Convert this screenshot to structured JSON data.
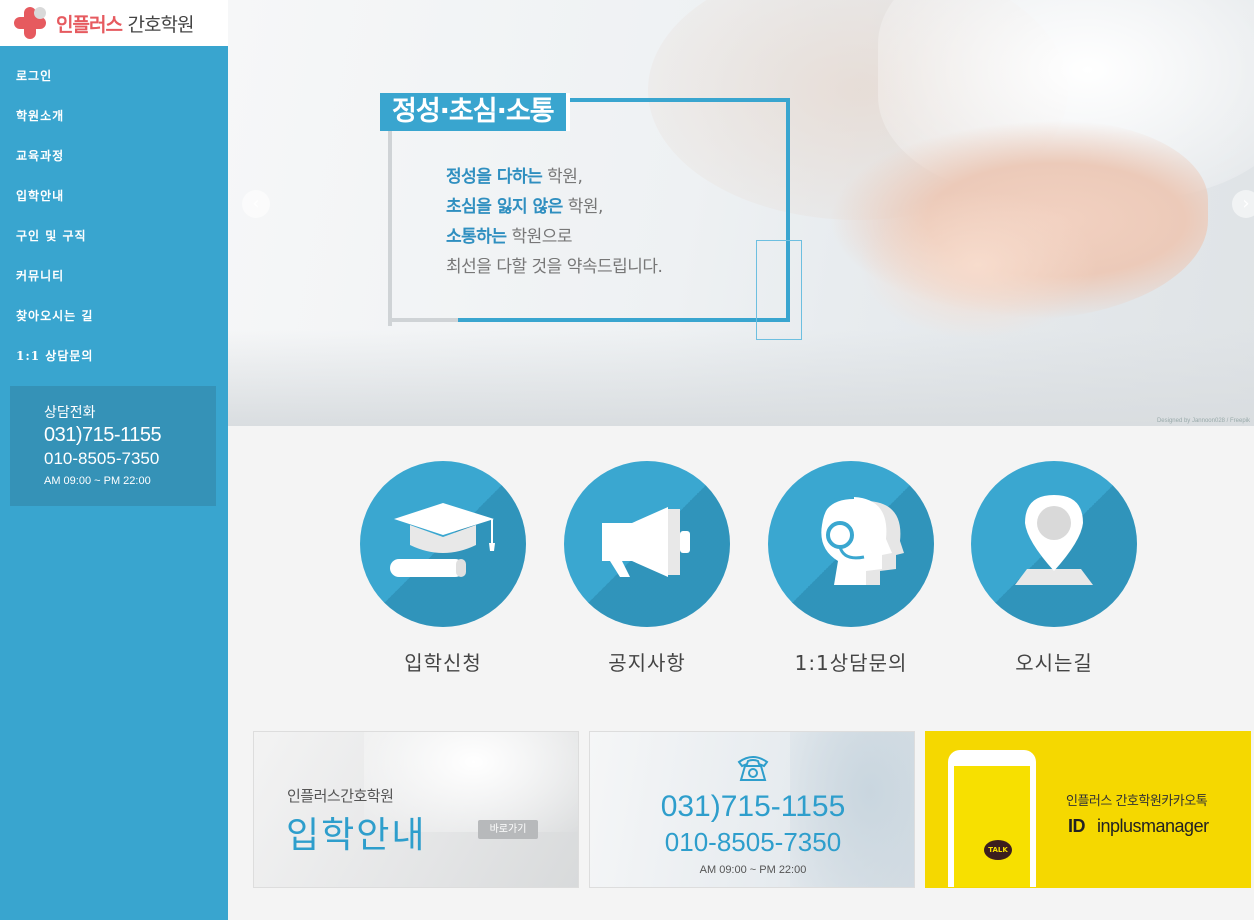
{
  "logo": {
    "name_red": "인플러스",
    "name_dark": "간호학원"
  },
  "sidebar": {
    "items": [
      {
        "label": "로그인"
      },
      {
        "label": "학원소개"
      },
      {
        "label": "교육과정"
      },
      {
        "label": "입학안내"
      },
      {
        "label": "구인 및 구직"
      },
      {
        "label": "커뮤니티"
      },
      {
        "label": "찾아오시는 길"
      },
      {
        "label": "1:1 상담문의"
      }
    ],
    "contact": {
      "label": "상담전화",
      "phone1": "031)715-1155",
      "phone2": "010-8505-7350",
      "hours": "AM 09:00 ~ PM 22:00"
    }
  },
  "hero": {
    "badge": "정성·초심·소통",
    "line1_em": "정성을 다하는",
    "line1_rest": " 학원,",
    "line2_em": "초심을 잃지 않은",
    "line2_rest": " 학원,",
    "line3_em": "소통하는",
    "line3_rest": " 학원으로",
    "line4": "최선을 다할 것을 약속드립니다.",
    "credit": "Designed by Jannoon028 / Freepik",
    "prev_arrow": "‹",
    "next_arrow": "›"
  },
  "quick_links": [
    {
      "label": "입학신청",
      "icon": "graduation-cap-icon"
    },
    {
      "label": "공지사항",
      "icon": "megaphone-icon"
    },
    {
      "label": "1:1상담문의",
      "icon": "headset-icon"
    },
    {
      "label": "오시는길",
      "icon": "map-pin-icon"
    }
  ],
  "banners": {
    "admission": {
      "subtitle": "인플러스간호학원",
      "title": "입학안내",
      "button": "바로가기"
    },
    "phone": {
      "phone1": "031)715-1155",
      "phone2": "010-8505-7350",
      "hours": "AM 09:00 ~ PM 22:00"
    },
    "kakao": {
      "title": "인플러스 간호학원카카오톡",
      "id_label": "ID",
      "id_value": "inplusmanager",
      "talk": "TALK"
    }
  },
  "colors": {
    "primary": "#39a5cf",
    "brand_red": "#e65a5f",
    "kakao_yellow": "#f5d800"
  }
}
